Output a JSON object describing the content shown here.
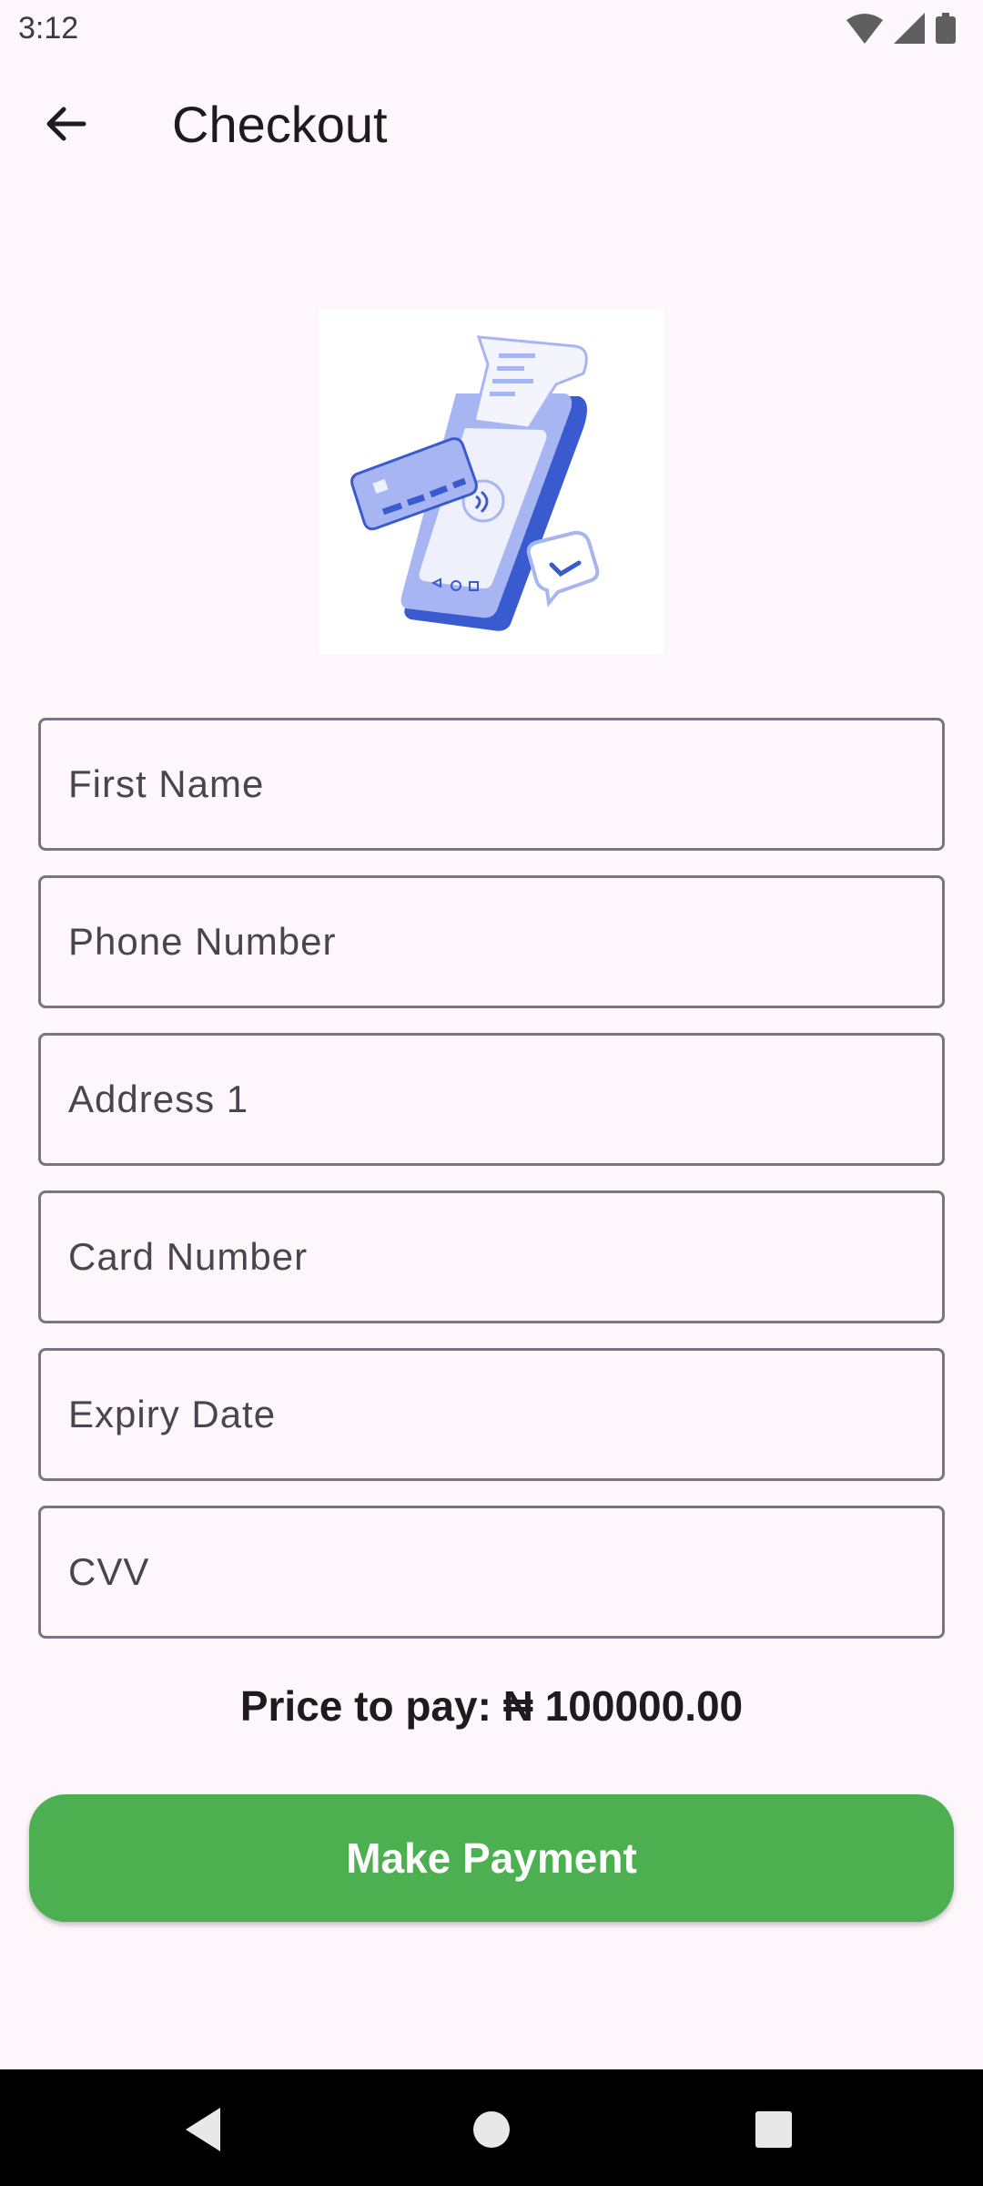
{
  "status_bar": {
    "time": "3:12",
    "icons": [
      "wifi-icon",
      "signal-icon",
      "battery-icon"
    ]
  },
  "app_bar": {
    "back_icon": "arrow-back-icon",
    "title": "Checkout"
  },
  "hero": {
    "icon": "payment-terminal-illustration",
    "colors": {
      "primary": "#3a5bd0",
      "light": "#a7b6f2"
    }
  },
  "form": {
    "fields": [
      {
        "placeholder": "First Name",
        "value": ""
      },
      {
        "placeholder": "Phone Number",
        "value": ""
      },
      {
        "placeholder": "Address 1",
        "value": ""
      },
      {
        "placeholder": "Card Number",
        "value": ""
      },
      {
        "placeholder": "Expiry Date",
        "value": ""
      },
      {
        "placeholder": "CVV",
        "value": ""
      }
    ]
  },
  "price": {
    "text": "Price to pay: ₦ 100000.00"
  },
  "actions": {
    "pay_label": "Make Payment",
    "pay_color": "#4caf50"
  },
  "nav_bar": {
    "icons": [
      "nav-back-icon",
      "nav-home-icon",
      "nav-recents-icon"
    ]
  }
}
